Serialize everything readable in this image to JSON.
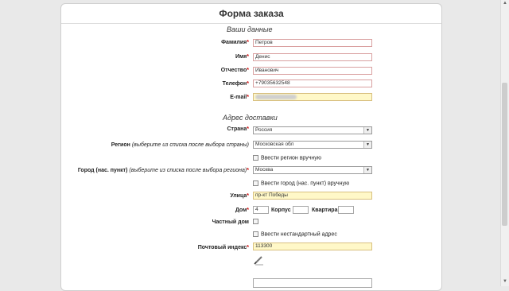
{
  "form": {
    "title": "Форма заказа",
    "personal_section": "Ваши данные",
    "delivery_section": "Адрес доставки",
    "required_mark": "*"
  },
  "personal": {
    "surname": {
      "label": "Фамилия",
      "value": "Петров"
    },
    "name": {
      "label": "Имя",
      "value": "Денис"
    },
    "patronymic": {
      "label": "Отчество",
      "value": "Иванович"
    },
    "phone": {
      "label": "Телефон",
      "value": "+79035632548"
    },
    "email": {
      "label": "E-mail"
    }
  },
  "delivery": {
    "country": {
      "label": "Страна",
      "value": "Россия"
    },
    "region": {
      "label": "Регион",
      "hint": "(выберите из списка после выбора страны)",
      "value": "Московская обл"
    },
    "region_manual": "Ввести регион вручную",
    "city": {
      "label": "Город (нас. пункт)",
      "hint": "(выберите из списка после выбора региона)",
      "value": "Москва"
    },
    "city_manual": "Ввести город (нас. пункт) вручную",
    "street": {
      "label": "Улица",
      "value": "пр-кт Победы"
    },
    "house": {
      "label": "Дом",
      "value": "4"
    },
    "building": {
      "label": "Корпус",
      "value": ""
    },
    "apartment": {
      "label": "Квартира",
      "value": ""
    },
    "private_house": "Частный дом",
    "custom_address": "Ввести нестандартный адрес",
    "postal": {
      "label": "Почтовый индекс",
      "value": "113300"
    }
  },
  "icons": {
    "pencil": "pencil-icon",
    "dropdown": "chevron-down-icon"
  },
  "colors": {
    "highlight": "#fff8c8",
    "required": "#cc0000"
  }
}
